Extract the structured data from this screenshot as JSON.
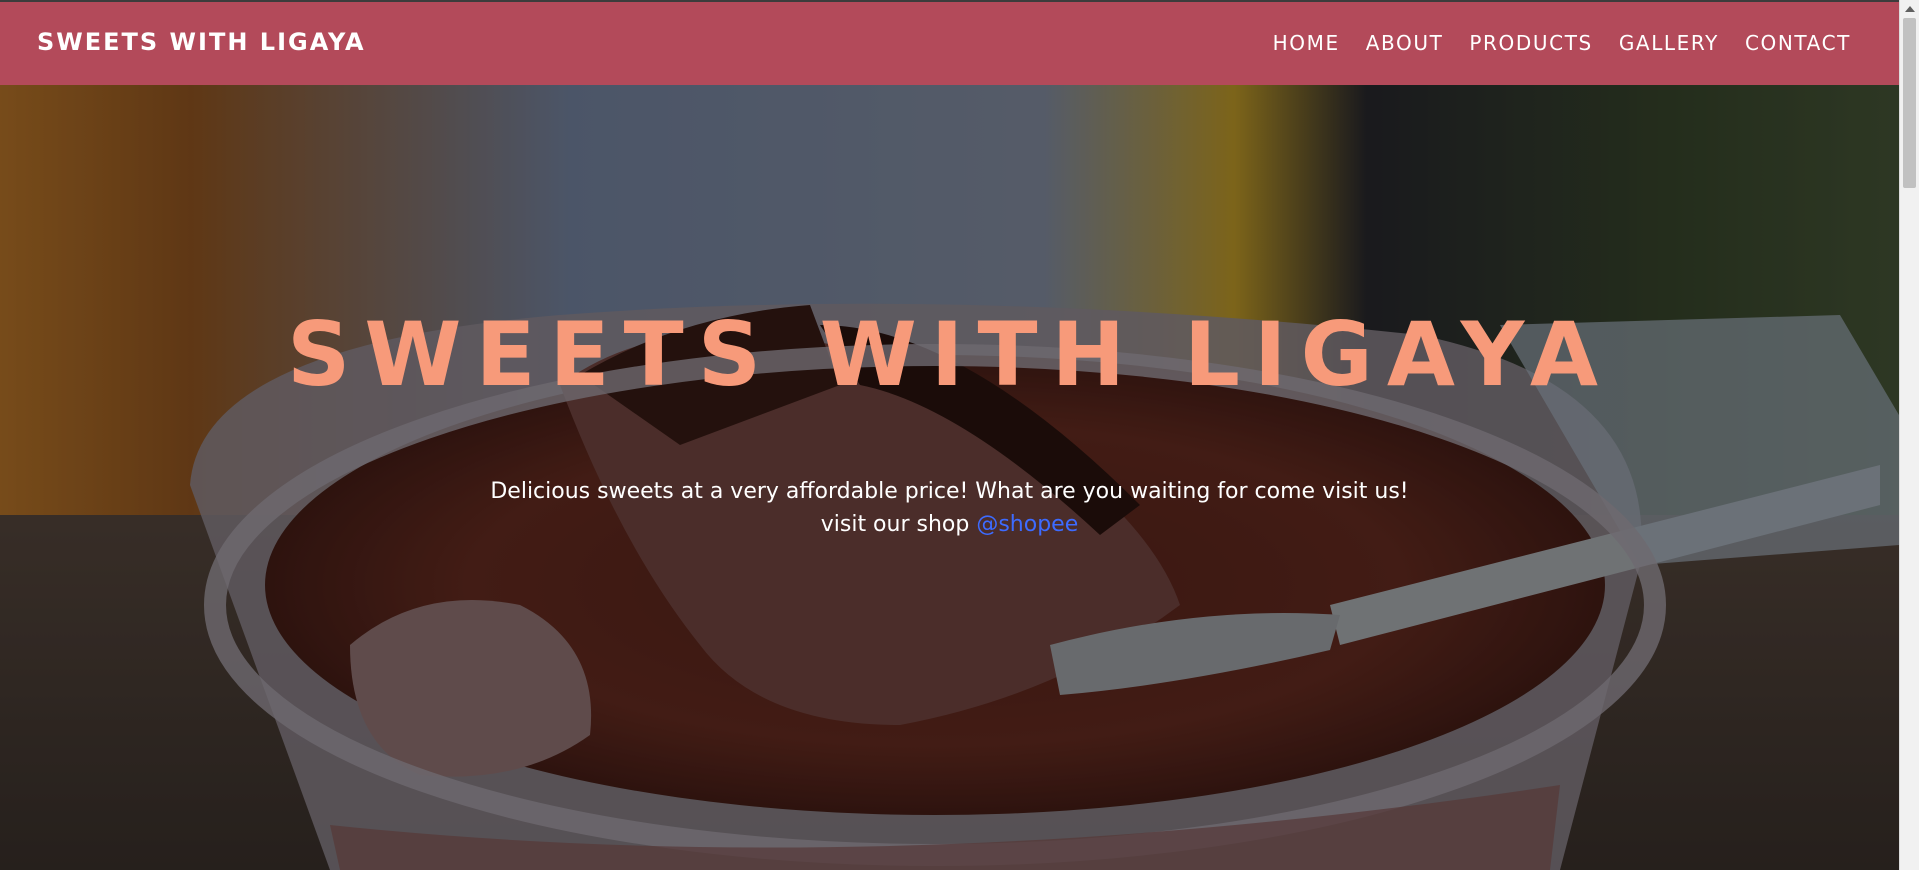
{
  "navbar": {
    "brand": "SWEETS WITH LIGAYA",
    "links": [
      "HOME",
      "ABOUT",
      "PRODUCTS",
      "GALLERY",
      "CONTACT"
    ],
    "background_color": "#b34a5a"
  },
  "hero": {
    "title": "SWEETS WITH LIGAYA",
    "line1": "Delicious sweets at a very affordable price! What are you waiting for come visit us!",
    "line2_prefix": "visit our shop",
    "shop_link": "@shopee",
    "title_color": "#f79a7a",
    "link_color": "#3d6bff",
    "background_image": "chocolate-cake-cup-photo"
  }
}
